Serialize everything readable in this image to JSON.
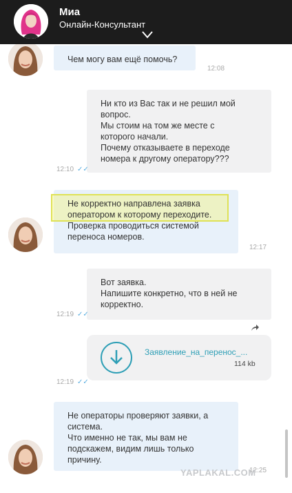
{
  "header": {
    "name": "Миа",
    "subtitle": "Онлайн-Консультант",
    "chevron_icon": "chevron-down-icon"
  },
  "messages": [
    {
      "id": "m1",
      "direction": "incoming",
      "text": "Чем могу вам ещё помочь?",
      "time": "12:08"
    },
    {
      "id": "m2",
      "direction": "outgoing",
      "text": "Ни кто из Вас так и не решил мой\nвопрос.\nМы стоим на том же месте с\nкоторого начали.\nПочему отказываете в переходе\nномера к другому оператору???",
      "time": "12:10",
      "read": true
    },
    {
      "id": "m3",
      "direction": "incoming",
      "text_highlighted": "Не корректно направлена заявка\nоператором к которому переходите.",
      "text_rest": "Проверка проводиться системой\nпереноса номеров.",
      "time": "12:17"
    },
    {
      "id": "m4",
      "direction": "outgoing",
      "text": "Вот заявка.\nНапишите конкретно, что в ней не\nкорректно.",
      "time": "12:19",
      "read": true
    },
    {
      "id": "m5",
      "direction": "outgoing",
      "type": "file",
      "file_name": "Заявление_на_перенос_...",
      "file_size": "114 kb",
      "time": "12:19",
      "read": true
    },
    {
      "id": "m6",
      "direction": "incoming",
      "text": "Не операторы проверяют заявки, а\nсистема.\nЧто именно не так, мы вам не\nподскажем, видим лишь только\nпричину.",
      "time": "12:25"
    }
  ],
  "watermark": "YAPLAKAL.COM",
  "colors": {
    "header_bg": "#1c1c1c",
    "incoming_bubble": "#e8f1fa",
    "outgoing_bubble": "#f1f1f2",
    "accent": "#2e9fb6",
    "read_check": "#5aaee0",
    "highlight": "#dfe255"
  }
}
